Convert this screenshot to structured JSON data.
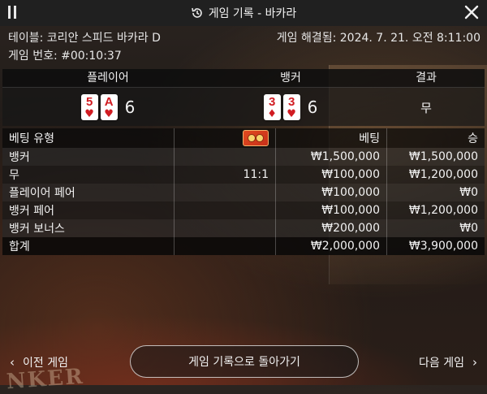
{
  "header": {
    "title": "게임 기록 - 바카라"
  },
  "info": {
    "table_label": "테이블: 코리안 스피드 바카라 D",
    "settled_label": "게임 해결됨: 2024. 7. 21. 오전 8:11:00",
    "game_number": "게임 번호: #00:10:37"
  },
  "results": {
    "headers": {
      "player": "플레이어",
      "banker": "뱅커",
      "outcome": "결과"
    },
    "player": {
      "cards": [
        {
          "rank": "5",
          "suit": "♥"
        },
        {
          "rank": "A",
          "suit": "♥"
        }
      ],
      "score": "6"
    },
    "banker": {
      "cards": [
        {
          "rank": "3",
          "suit": "♦"
        },
        {
          "rank": "3",
          "suit": "♥"
        }
      ],
      "score": "6"
    },
    "outcome": "무"
  },
  "bets": {
    "headers": {
      "type": "베팅 유형",
      "bet": "베팅",
      "win": "승"
    },
    "rows": [
      {
        "type": "뱅커",
        "odds": "",
        "bet": "₩1,500,000",
        "win": "₩1,500,000"
      },
      {
        "type": "무",
        "odds": "11:1",
        "bet": "₩100,000",
        "win": "₩1,200,000"
      },
      {
        "type": "플레이어 페어",
        "odds": "",
        "bet": "₩100,000",
        "win": "₩0"
      },
      {
        "type": "뱅커 페어",
        "odds": "",
        "bet": "₩100,000",
        "win": "₩1,200,000"
      },
      {
        "type": "뱅커 보너스",
        "odds": "",
        "bet": "₩200,000",
        "win": "₩0"
      }
    ],
    "total": {
      "type": "합계",
      "bet": "₩2,000,000",
      "win": "₩3,900,000"
    }
  },
  "footer": {
    "prev": "이전 게임",
    "back": "게임 기록으로 돌아가기",
    "next": "다음 게임"
  },
  "background_text": "NKER"
}
